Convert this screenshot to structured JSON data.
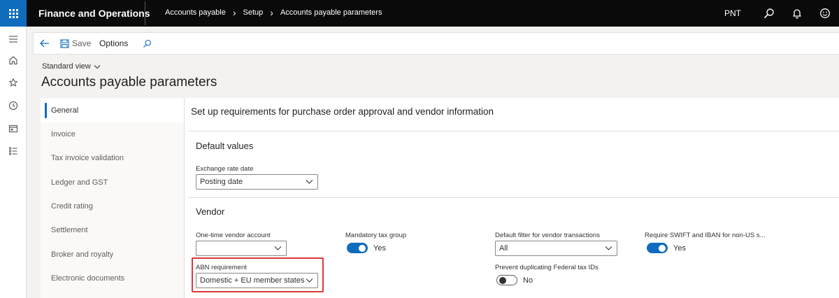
{
  "topbar": {
    "app_title": "Finance and Operations",
    "breadcrumb": [
      "Accounts payable",
      "Setup",
      "Accounts payable parameters"
    ],
    "company": "PNT"
  },
  "action_pane": {
    "save_label": "Save",
    "options_label": "Options"
  },
  "header": {
    "view_label": "Standard view",
    "page_title": "Accounts payable parameters"
  },
  "side_tabs": [
    {
      "label": "General",
      "active": true
    },
    {
      "label": "Invoice",
      "active": false
    },
    {
      "label": "Tax invoice validation",
      "active": false
    },
    {
      "label": "Ledger and GST",
      "active": false
    },
    {
      "label": "Credit rating",
      "active": false
    },
    {
      "label": "Settlement",
      "active": false
    },
    {
      "label": "Broker and royalty",
      "active": false
    },
    {
      "label": "Electronic documents",
      "active": false
    }
  ],
  "content": {
    "title": "Set up requirements for purchase order approval and vendor information",
    "default_values": {
      "heading": "Default values",
      "exchange_rate_date": {
        "label": "Exchange rate date",
        "value": "Posting date"
      }
    },
    "vendor": {
      "heading": "Vendor",
      "one_time_vendor_account": {
        "label": "One-time vendor account",
        "value": ""
      },
      "abn_requirement": {
        "label": "ABN requirement",
        "value": "Domestic + EU member states"
      },
      "mandatory_tax_group": {
        "label": "Mandatory tax group",
        "value": "Yes",
        "on": true
      },
      "default_filter": {
        "label": "Default filter for vendor transactions",
        "value": "All"
      },
      "prevent_duplicating": {
        "label": "Prevent duplicating Federal tax IDs",
        "value": "No",
        "on": false
      },
      "require_swift": {
        "label": "Require SWIFT and IBAN for non-US s...",
        "value": "Yes",
        "on": true
      }
    }
  },
  "colors": {
    "accent": "#0f6cbd",
    "topbar": "#0a0a0a",
    "highlight": "#d93a3a"
  }
}
